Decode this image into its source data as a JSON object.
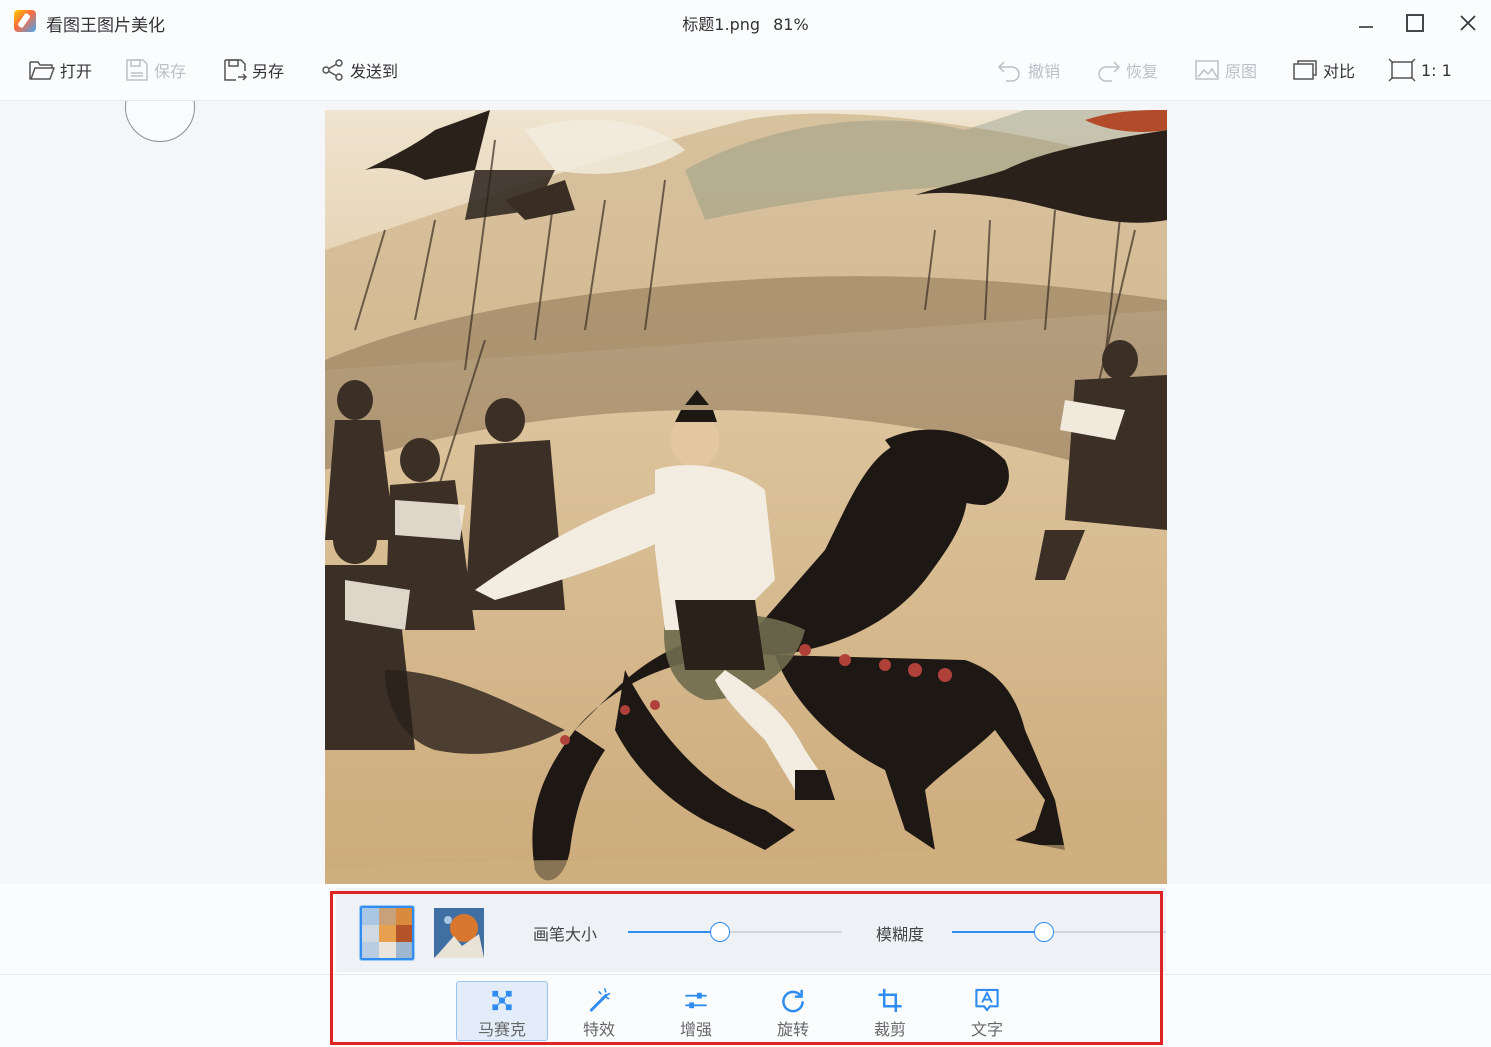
{
  "app": {
    "name": "看图王图片美化",
    "file_name": "标题1.png",
    "zoom": "81%"
  },
  "window_controls": {
    "minimize_icon": "minimize-icon",
    "maximize_icon": "maximize-icon",
    "close_icon": "close-icon"
  },
  "toolbar": {
    "open": {
      "label": "打开",
      "icon": "folder-open-icon",
      "enabled": true
    },
    "save": {
      "label": "保存",
      "icon": "save-icon",
      "enabled": false
    },
    "save_as": {
      "label": "另存",
      "icon": "save-as-icon",
      "enabled": true
    },
    "send_to": {
      "label": "发送到",
      "icon": "share-icon",
      "enabled": true
    },
    "undo": {
      "label": "撤销",
      "icon": "undo-icon",
      "enabled": false
    },
    "redo": {
      "label": "恢复",
      "icon": "redo-icon",
      "enabled": false
    },
    "original": {
      "label": "原图",
      "icon": "image-icon",
      "enabled": false
    },
    "compare": {
      "label": "对比",
      "icon": "compare-icon",
      "enabled": true
    },
    "actual_size": {
      "label": "1: 1",
      "icon": "actual-size-icon",
      "enabled": true
    }
  },
  "mosaic_panel": {
    "styles": [
      {
        "name": "mosaic-pixel",
        "selected": true
      },
      {
        "name": "mosaic-artistic",
        "selected": false
      }
    ],
    "brush_size": {
      "label": "画笔大小",
      "value": 0.43
    },
    "blur": {
      "label": "模糊度",
      "value": 0.43
    }
  },
  "tools": [
    {
      "label": "马赛克",
      "icon": "mosaic-icon",
      "active": true
    },
    {
      "label": "特效",
      "icon": "magic-wand-icon",
      "active": false
    },
    {
      "label": "增强",
      "icon": "adjust-sliders-icon",
      "active": false
    },
    {
      "label": "旋转",
      "icon": "rotate-icon",
      "active": false
    },
    {
      "label": "裁剪",
      "icon": "crop-icon",
      "active": false
    },
    {
      "label": "文字",
      "icon": "text-icon",
      "active": false
    }
  ],
  "colors": {
    "accent": "#2f8cf0",
    "highlight": "#e02424",
    "disabled_text": "#bcc0c6"
  }
}
